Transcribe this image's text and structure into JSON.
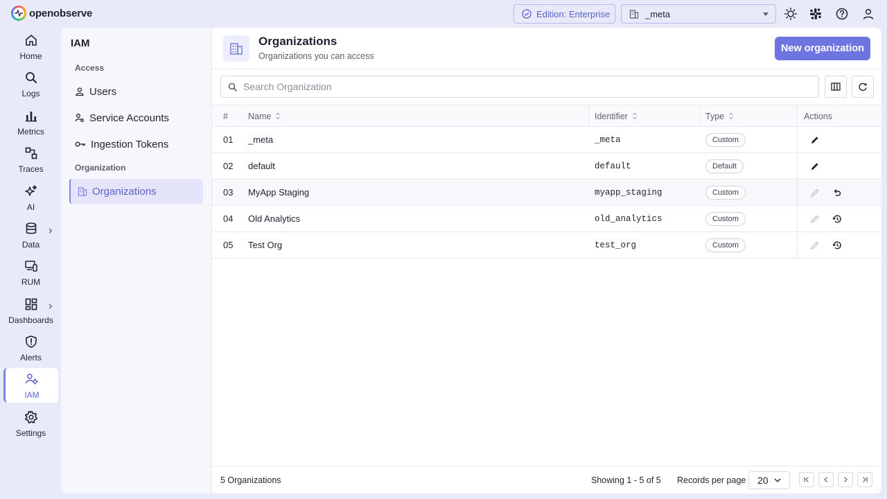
{
  "app": {
    "name": "openobserve"
  },
  "topbar": {
    "edition_label": "Edition: Enterprise",
    "org_selected": "_meta"
  },
  "nav": [
    {
      "label": "Home",
      "icon": "home-icon"
    },
    {
      "label": "Logs",
      "icon": "search-icon"
    },
    {
      "label": "Metrics",
      "icon": "bar-chart-icon"
    },
    {
      "label": "Traces",
      "icon": "traces-icon"
    },
    {
      "label": "AI",
      "icon": "sparkles-icon"
    },
    {
      "label": "Data",
      "icon": "database-icon"
    },
    {
      "label": "RUM",
      "icon": "devices-icon"
    },
    {
      "label": "Dashboards",
      "icon": "dashboard-icon"
    },
    {
      "label": "Alerts",
      "icon": "alert-shield-icon"
    },
    {
      "label": "IAM",
      "icon": "iam-icon"
    },
    {
      "label": "Settings",
      "icon": "gear-icon"
    }
  ],
  "iam": {
    "title": "IAM",
    "section_access": "Access",
    "section_org": "Organization",
    "items": [
      {
        "label": "Users",
        "icon": "user-icon"
      },
      {
        "label": "Service Accounts",
        "icon": "service-account-icon"
      },
      {
        "label": "Ingestion Tokens",
        "icon": "key-icon"
      },
      {
        "label": "Organizations",
        "icon": "building-icon"
      }
    ]
  },
  "page": {
    "title": "Organizations",
    "subtitle": "Organizations you can access",
    "new_button": "New organization",
    "search_placeholder": "Search Organization"
  },
  "table": {
    "columns": {
      "num": "#",
      "name": "Name",
      "identifier": "Identifier",
      "type": "Type",
      "actions": "Actions"
    },
    "rows": [
      {
        "num": "01",
        "name": "_meta",
        "identifier": "_meta",
        "type": "Custom"
      },
      {
        "num": "02",
        "name": "default",
        "identifier": "default",
        "type": "Default"
      },
      {
        "num": "03",
        "name": "MyApp Staging",
        "identifier": "myapp_staging",
        "type": "Custom"
      },
      {
        "num": "04",
        "name": "Old Analytics",
        "identifier": "old_analytics",
        "type": "Custom"
      },
      {
        "num": "05",
        "name": "Test Org",
        "identifier": "test_org",
        "type": "Custom"
      }
    ]
  },
  "footer": {
    "count": "5 Organizations",
    "showing": "Showing 1 - 5 of 5",
    "records_per_page_label": "Records per page",
    "records_per_page_value": "20"
  },
  "colors": {
    "accent": "#6e74e0",
    "background": "#e9eaf9"
  }
}
